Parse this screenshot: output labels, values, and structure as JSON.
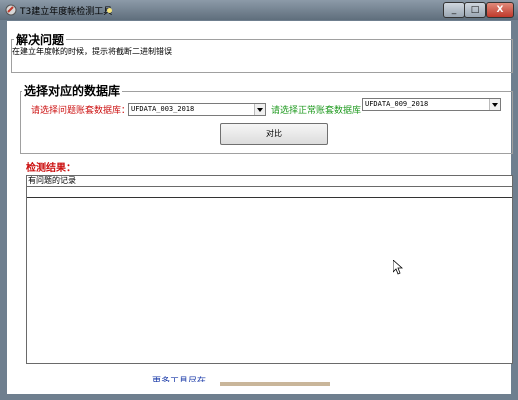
{
  "window": {
    "title": "T3建立年度帐检测工具",
    "controls": {
      "minimize": "_",
      "maximize": "□",
      "close": "X"
    }
  },
  "section_problem": {
    "title": "解决问题",
    "description": "在建立年度帐的时候，提示将截断二进制错误"
  },
  "section_db": {
    "title": "选择对应的数据库",
    "problem_label": "请选择问题账套数据库：",
    "problem_value": "UFDATA_003_2018",
    "normal_label": "请选择正常账套数据库",
    "normal_value": "UFDATA_009_2018",
    "compare_button": "对比"
  },
  "results": {
    "label": "检测结果：",
    "column_header": "有问题的记录"
  },
  "footer": {
    "link_text": "更多工具尽在"
  },
  "colors": {
    "label_red": "#cc1111",
    "label_green": "#1f9a1f",
    "link_blue": "#1a3aa8"
  }
}
